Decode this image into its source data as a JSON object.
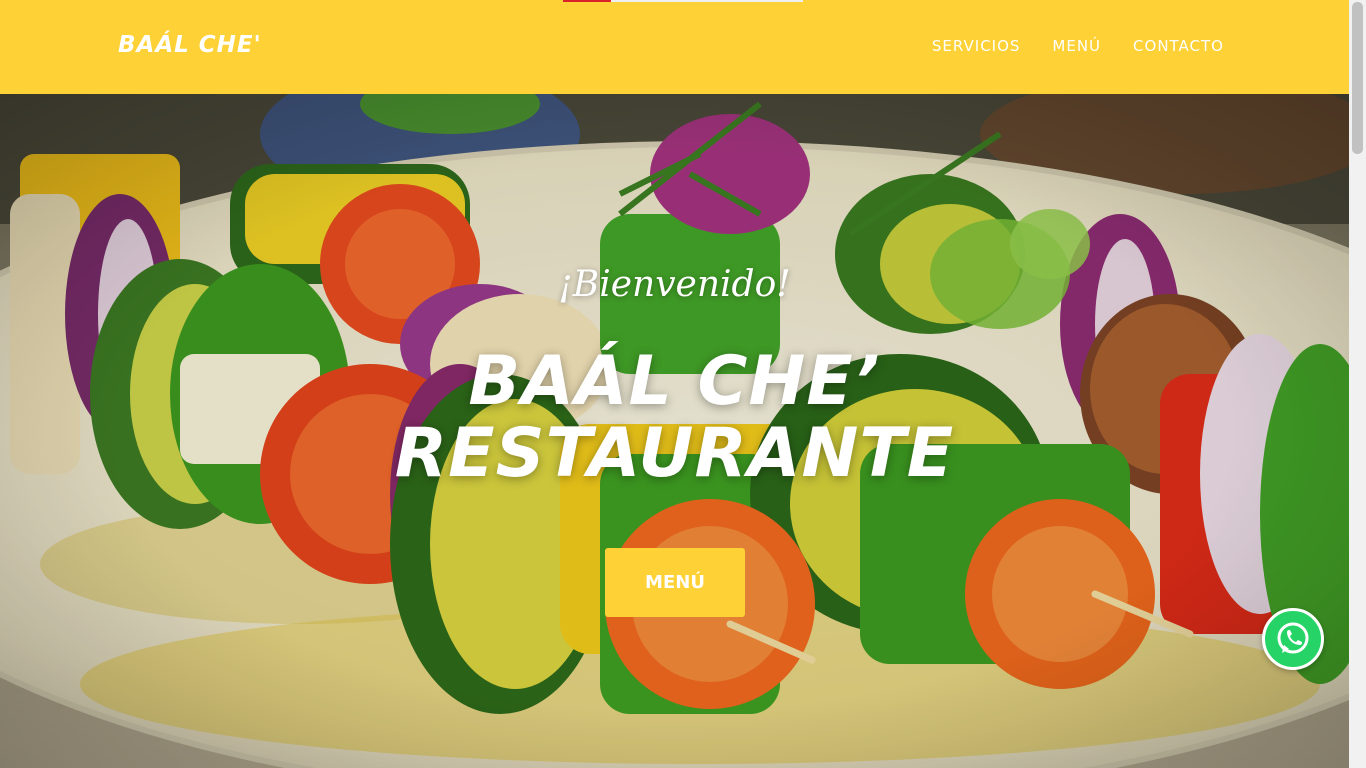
{
  "navbar": {
    "brand": "BAÁL CHE'",
    "links": [
      {
        "label": "SERVICIOS"
      },
      {
        "label": "MENÚ"
      },
      {
        "label": "CONTACTO"
      }
    ],
    "background_color": "#fed136"
  },
  "hero": {
    "subheading": "¡Bienvenido!",
    "heading_line1": "BAÁL CHE’",
    "heading_line2": "RESTAURANTE",
    "button_label": "MENÚ",
    "background_image": "vegetable-skewers-photo"
  },
  "floating": {
    "whatsapp_icon": "whatsapp-icon",
    "whatsapp_color": "#25d366"
  },
  "accent_color": "#d9222a"
}
